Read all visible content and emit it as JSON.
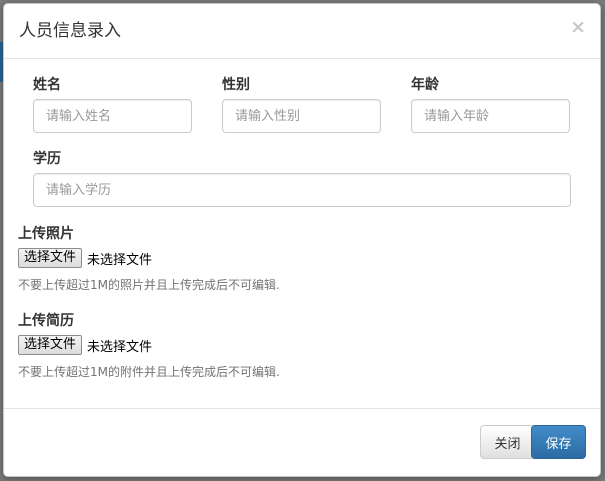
{
  "modal": {
    "title": "人员信息录入",
    "close_glyph": "×"
  },
  "form": {
    "name": {
      "label": "姓名",
      "placeholder": "请输入姓名"
    },
    "gender": {
      "label": "性别",
      "placeholder": "请输入性别"
    },
    "age": {
      "label": "年龄",
      "placeholder": "请输入年龄"
    },
    "education": {
      "label": "学历",
      "placeholder": "请输入学历"
    },
    "photo": {
      "label": "上传照片",
      "button": "选择文件",
      "status": "未选择文件",
      "help": "不要上传超过1M的照片并且上传完成后不可编辑."
    },
    "resume": {
      "label": "上传简历",
      "button": "选择文件",
      "status": "未选择文件",
      "help": "不要上传超过1M的附件并且上传完成后不可编辑."
    }
  },
  "footer": {
    "close_label": "关闭",
    "save_label": "保存"
  },
  "colors": {
    "primary": "#428bca",
    "backdrop": "#7a7a7a"
  }
}
